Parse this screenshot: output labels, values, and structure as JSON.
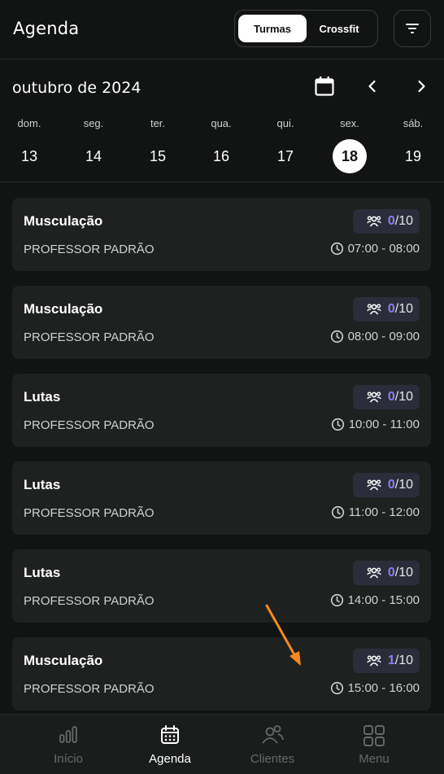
{
  "header": {
    "title": "Agenda",
    "segments": [
      "Turmas",
      "Crossfit"
    ],
    "selected_segment": "Turmas"
  },
  "calendar": {
    "month_label": "outubro de 2024",
    "days": [
      {
        "name": "dom.",
        "num": "13"
      },
      {
        "name": "seg.",
        "num": "14"
      },
      {
        "name": "ter.",
        "num": "15"
      },
      {
        "name": "qua.",
        "num": "16"
      },
      {
        "name": "qui.",
        "num": "17"
      },
      {
        "name": "sex.",
        "num": "18"
      },
      {
        "name": "sáb.",
        "num": "19"
      }
    ],
    "selected_day": "18"
  },
  "classes": [
    {
      "title": "Musculação",
      "professor": "PROFESSOR PADRÃO",
      "current": "0",
      "sep": "/",
      "max": "10",
      "time": "07:00 - 08:00"
    },
    {
      "title": "Musculação",
      "professor": "PROFESSOR PADRÃO",
      "current": "0",
      "sep": "/",
      "max": "10",
      "time": "08:00 - 09:00"
    },
    {
      "title": "Lutas",
      "professor": "PROFESSOR PADRÃO",
      "current": "0",
      "sep": "/",
      "max": "10",
      "time": "10:00 - 11:00"
    },
    {
      "title": "Lutas",
      "professor": "PROFESSOR PADRÃO",
      "current": "0",
      "sep": "/",
      "max": "10",
      "time": "11:00 - 12:00"
    },
    {
      "title": "Lutas",
      "professor": "PROFESSOR PADRÃO",
      "current": "0",
      "sep": "/",
      "max": "10",
      "time": "14:00 - 15:00"
    },
    {
      "title": "Musculação",
      "professor": "PROFESSOR PADRÃO",
      "current": "1",
      "sep": "/",
      "max": "10",
      "time": "15:00 - 16:00"
    }
  ],
  "bottom_nav": {
    "items": [
      {
        "label": "Início",
        "icon": "chart-bars-icon"
      },
      {
        "label": "Agenda",
        "icon": "calendar-icon"
      },
      {
        "label": "Clientes",
        "icon": "users-icon"
      },
      {
        "label": "Menu",
        "icon": "grid-icon"
      }
    ],
    "active": "Agenda"
  },
  "colors": {
    "background": "#121413",
    "card": "#1f2120",
    "accent": "#8f7cf5",
    "annotation_arrow": "#f5891f"
  }
}
